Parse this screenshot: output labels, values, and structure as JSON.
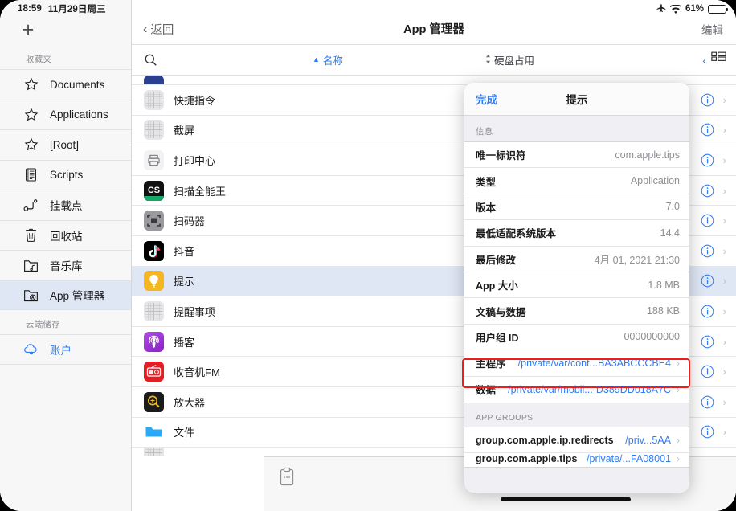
{
  "status_bar": {
    "time": "18:59",
    "date": "11月29日周三",
    "airplane_icon": "airplane-icon",
    "wifi_icon": "wifi-icon",
    "battery_percent": "61%",
    "battery_level": 61,
    "charging": true
  },
  "sidebar": {
    "add_label": "+",
    "sections": [
      {
        "label": "收藏夹",
        "items": [
          {
            "label": "Documents",
            "icon": "star-icon",
            "selected": false,
            "blue": false
          },
          {
            "label": "Applications",
            "icon": "star-icon",
            "selected": false,
            "blue": false
          },
          {
            "label": "[Root]",
            "icon": "star-icon",
            "selected": false,
            "blue": false
          },
          {
            "label": "Scripts",
            "icon": "script-document-icon",
            "selected": false,
            "blue": false
          },
          {
            "label": "挂载点",
            "icon": "mount-point-icon",
            "selected": false,
            "blue": false
          },
          {
            "label": "回收站",
            "icon": "trash-icon",
            "selected": false,
            "blue": false
          },
          {
            "label": "音乐库",
            "icon": "music-folder-icon",
            "selected": false,
            "blue": false
          },
          {
            "label": "App 管理器",
            "icon": "app-folder-icon",
            "selected": true,
            "blue": false
          }
        ]
      },
      {
        "label": "云端储存",
        "items": [
          {
            "label": "账户",
            "icon": "cloud-add-icon",
            "selected": false,
            "blue": true
          }
        ]
      }
    ]
  },
  "header": {
    "back_label": "返回",
    "title": "App 管理器",
    "edit_label": "编辑"
  },
  "sortbar": {
    "search_icon": "search-icon",
    "sort_name_label": "名称",
    "sort_name_caret": "▲",
    "sort_disk_label": "硬盘占用",
    "sort_disk_caret": "⌃⌄",
    "view_chevron": "‹",
    "view_toggle_icon": "list-view-icon"
  },
  "app_list": {
    "rows": [
      {
        "name": "",
        "icon_type": "partial",
        "icon_color": "#2b3f8f",
        "selected": false,
        "partial": "top"
      },
      {
        "name": "快捷指令",
        "icon_type": "grid",
        "icon_color": "#e6e6e8",
        "selected": false
      },
      {
        "name": "截屏",
        "icon_type": "grid",
        "icon_color": "#e6e6e8",
        "selected": false
      },
      {
        "name": "打印中心",
        "icon_type": "printer",
        "icon_color": "#f2f2f4",
        "selected": false
      },
      {
        "name": "扫描全能王",
        "icon_type": "camscanner",
        "icon_color": "#111111",
        "selected": false
      },
      {
        "name": "扫码器",
        "icon_type": "qrscan",
        "icon_color": "#8e8e93",
        "selected": false
      },
      {
        "name": "抖音",
        "icon_type": "douyin",
        "icon_color": "#000000",
        "selected": false
      },
      {
        "name": "提示",
        "icon_type": "tips",
        "icon_color": "#f5b721",
        "selected": true
      },
      {
        "name": "提醒事项",
        "icon_type": "grid",
        "icon_color": "#e6e6e8",
        "selected": false
      },
      {
        "name": "播客",
        "icon_type": "podcast",
        "icon_color": "#9b3cd4",
        "selected": false
      },
      {
        "name": "收音机FM",
        "icon_type": "radio",
        "icon_color": "#e01f26",
        "selected": false
      },
      {
        "name": "放大器",
        "icon_type": "magnifier",
        "icon_color": "#1b1b1b",
        "selected": false
      },
      {
        "name": "文件",
        "icon_type": "files",
        "icon_color": "#ffffff",
        "selected": false
      },
      {
        "name": "",
        "icon_type": "grid",
        "icon_color": "#e6e6e8",
        "selected": false,
        "partial": "bottom"
      }
    ],
    "info_icon": "info-circle-icon",
    "row_chevron": "›"
  },
  "popover": {
    "done_label": "完成",
    "title": "提示",
    "info_section_label": "信息",
    "info_rows": [
      {
        "label": "唯一标识符",
        "value": "com.apple.tips",
        "link": false,
        "chevron": false
      },
      {
        "label": "类型",
        "value": "Application",
        "link": false,
        "chevron": false
      },
      {
        "label": "版本",
        "value": "7.0",
        "link": false,
        "chevron": false
      },
      {
        "label": "最低适配系统版本",
        "value": "14.4",
        "link": false,
        "chevron": false
      },
      {
        "label": "最后修改",
        "value": "4月 01, 2021 21:30",
        "link": false,
        "chevron": false
      },
      {
        "label": "App 大小",
        "value": "1.8 MB",
        "link": false,
        "chevron": false
      },
      {
        "label": "文稿与数据",
        "value": "188 KB",
        "link": false,
        "chevron": false
      },
      {
        "label": "用户组 ID",
        "value": "0000000000",
        "link": false,
        "chevron": false
      },
      {
        "label": "主程序",
        "value": "/private/var/cont...BA3ABCCCBE4",
        "link": true,
        "chevron": true,
        "highlighted": true
      },
      {
        "label": "数据",
        "value": "/private/var/mobil...-D389DD018A7C",
        "link": true,
        "chevron": true
      }
    ],
    "app_groups_label": "APP GROUPS",
    "app_group_rows": [
      {
        "label": "group.com.apple.ip.redirects",
        "value": "/priv...5AA",
        "link": true,
        "chevron": true
      },
      {
        "label": "group.com.apple.tips",
        "value": "/private/...FA08001",
        "link": true,
        "chevron": true,
        "partial": true
      }
    ]
  },
  "bottom_bar": {
    "clipboard_icon": "clipboard-icon",
    "recents_icon": "clock-icon",
    "windows_icon": "copy-windows-icon"
  },
  "annotation": {
    "highlight_color": "#ee1c1c"
  },
  "colors": {
    "accent_blue": "#2f7cf6",
    "selection_blue": "#dfe7f5",
    "sidebar_bg": "#f7f7f7",
    "popover_bg": "#efeff4"
  }
}
